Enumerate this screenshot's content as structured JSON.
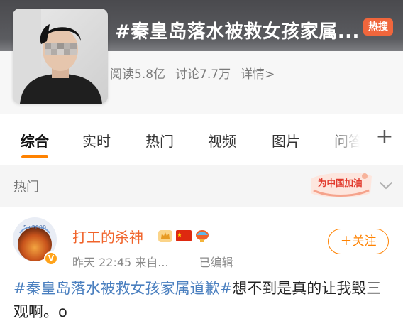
{
  "topic": {
    "title": "#秦皇岛落水被救女孩家属...",
    "hot_badge": "热搜",
    "reads": "阅读5.8亿",
    "discussions": "讨论7.7万",
    "details": "详情>"
  },
  "tabs": [
    {
      "label": "综合",
      "active": true
    },
    {
      "label": "实时",
      "active": false
    },
    {
      "label": "热门",
      "active": false
    },
    {
      "label": "视频",
      "active": false
    },
    {
      "label": "图片",
      "active": false
    },
    {
      "label": "问答",
      "active": false
    }
  ],
  "section": {
    "label": "热门",
    "banner_text": "为中国加油"
  },
  "post": {
    "avatar_text": "5+2000",
    "username": "打工的杀神",
    "time": "昨天 22:45",
    "source": "来自...",
    "edited": "已编辑",
    "follow_label": "＋关注",
    "hashtag": "#秦皇岛落水被救女孩家属道歉#",
    "text": "想不到是真的让我毁三观啊。o"
  },
  "colors": {
    "accent": "#ff8200",
    "username": "#f0632a",
    "hashtag": "#4a7fbf",
    "hot_badge": "#f0663c"
  },
  "icons": [
    "plus-icon",
    "chevron-down-icon",
    "verified-icon",
    "crown-badge-icon",
    "china-flag-icon",
    "lantern-icon"
  ]
}
